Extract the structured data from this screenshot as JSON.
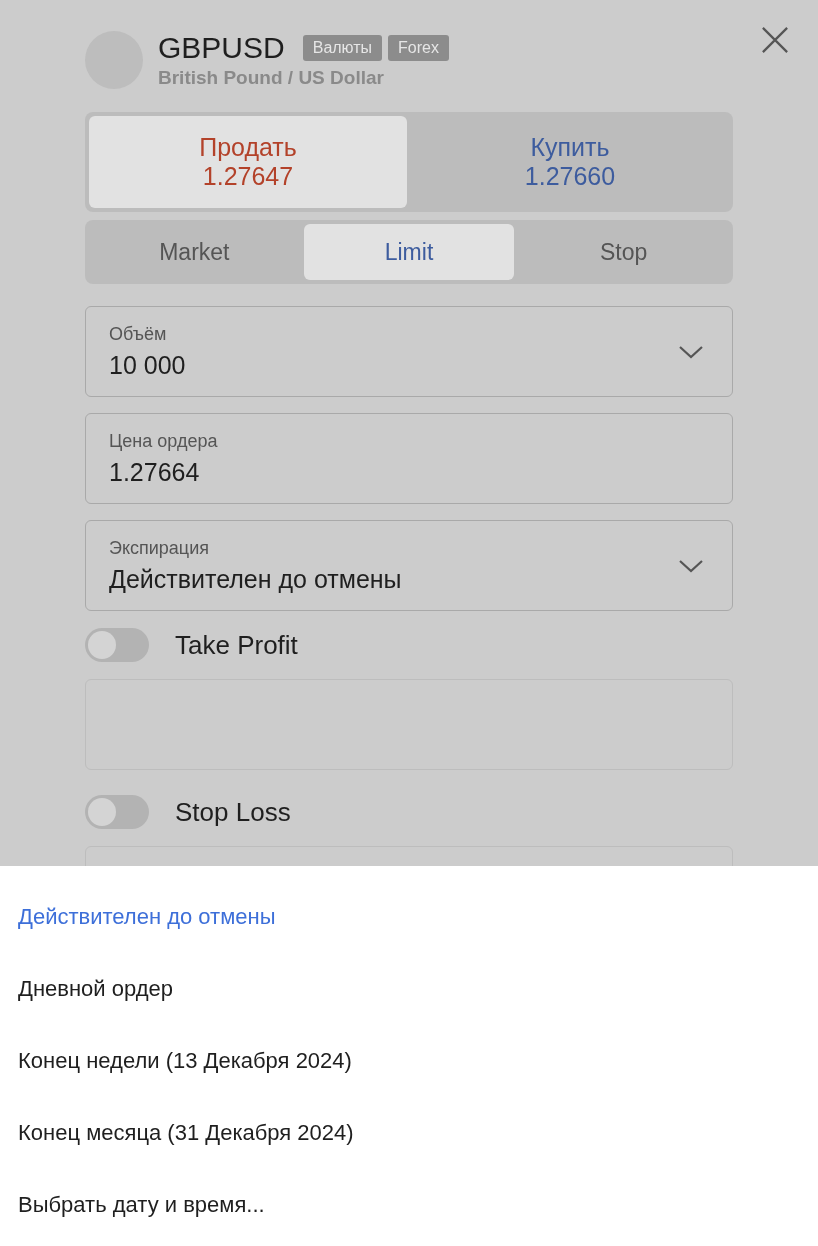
{
  "instrument": {
    "symbol": "GBPUSD",
    "tags": [
      "Валюты",
      "Forex"
    ],
    "name": "British Pound / US Dollar"
  },
  "sides": [
    {
      "kind": "sell",
      "label": "Продать",
      "price": "1.27647",
      "selected": true
    },
    {
      "kind": "buy",
      "label": "Купить",
      "price": "1.27660",
      "selected": false
    }
  ],
  "order_types": [
    {
      "label": "Market",
      "selected": false
    },
    {
      "label": "Limit",
      "selected": true
    },
    {
      "label": "Stop",
      "selected": false
    }
  ],
  "fields": [
    {
      "label": "Объём",
      "value": "10 000",
      "dropdown": true
    },
    {
      "label": "Цена ордера",
      "value": "1.27664",
      "dropdown": false
    },
    {
      "label": "Экспирация",
      "value": "Действителен до отмены",
      "dropdown": true
    }
  ],
  "toggles": [
    {
      "label": "Take Profit",
      "on": false
    },
    {
      "label": "Stop Loss",
      "on": false
    }
  ],
  "expiration_options": [
    {
      "label": "Действителен до отмены",
      "selected": true
    },
    {
      "label": "Дневной ордер",
      "selected": false
    },
    {
      "label": "Конец недели (13 Декабря 2024)",
      "selected": false
    },
    {
      "label": "Конец месяца (31 Декабря 2024)",
      "selected": false
    },
    {
      "label": "Выбрать дату и время...",
      "selected": false
    }
  ]
}
